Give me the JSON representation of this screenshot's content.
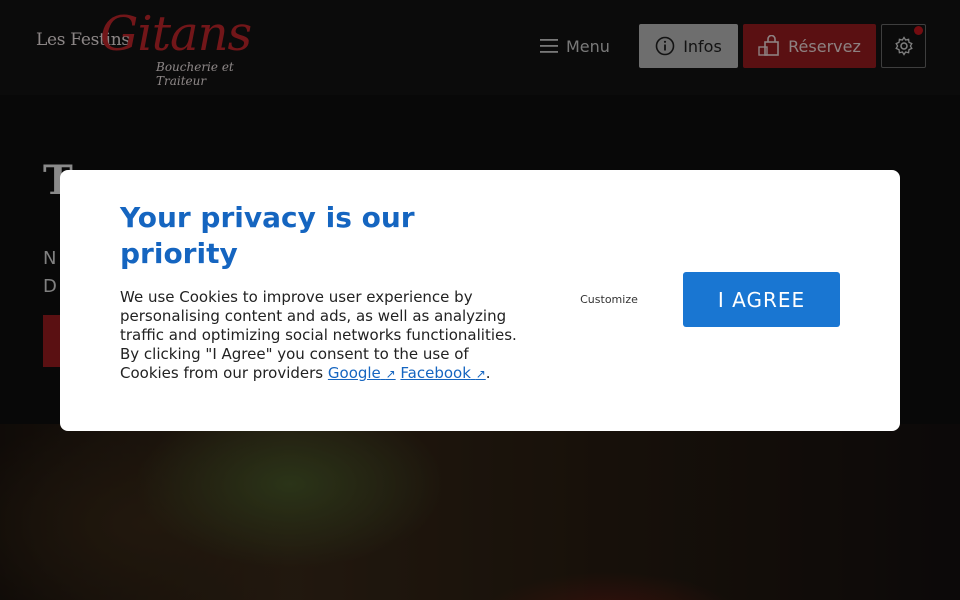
{
  "header": {
    "logo": {
      "line1": "Les Festins",
      "line2": "Gitans",
      "line3": "Boucherie et Traiteur"
    },
    "menu_label": "Menu",
    "infos_label": "Infos",
    "reserve_label": "Réservez"
  },
  "hero": {
    "title": "T",
    "subtitle_line1": "N",
    "subtitle_line2": "D"
  },
  "modal": {
    "title": "Your privacy is our priority",
    "body": "We use Cookies to improve user experience by personalising content and ads, as well as analyzing traffic and optimizing social networks functionalities. By clicking \"I Agree\" you consent to the use of Cookies from our providers",
    "link_google": "Google",
    "link_facebook": "Facebook",
    "period": ".",
    "customize_label": "Customize",
    "agree_label": "I AGREE"
  },
  "icons": [
    "hamburger-icon",
    "info-icon",
    "shopping-bag-icon",
    "gear-icon",
    "external-link-icon"
  ],
  "colors": {
    "accent_red": "#9b1c20",
    "modal_blue": "#1565c0",
    "agree_blue": "#1976d2"
  }
}
